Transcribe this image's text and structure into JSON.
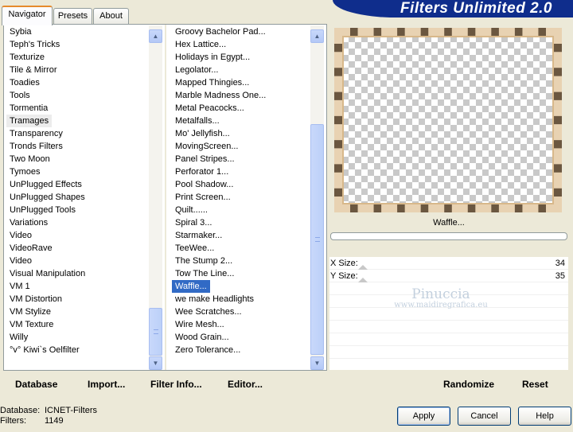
{
  "tabs": [
    {
      "label": "Navigator"
    },
    {
      "label": "Presets"
    },
    {
      "label": "About"
    }
  ],
  "header": {
    "title": "Filters Unlimited 2.0"
  },
  "categories": [
    "Sybia",
    "Teph's Tricks",
    "Texturize",
    "Tile & Mirror",
    "Toadies",
    "Tools",
    "Tormentia",
    "Tramages",
    "Transparency",
    "Tronds Filters",
    "Two Moon",
    "Tymoes",
    "UnPlugged Effects",
    "UnPlugged Shapes",
    "UnPlugged Tools",
    "Variations",
    "Video",
    "VideoRave",
    "Video",
    "Visual Manipulation",
    "VM 1",
    "VM Distortion",
    "VM Stylize",
    "VM Texture",
    "Willy",
    "°v° Kiwi`s Oelfilter"
  ],
  "selected_category": "Tramages",
  "filters": [
    "Groovy Bachelor Pad...",
    "Hex Lattice...",
    "Holidays in Egypt...",
    "Legolator...",
    "Mapped Thingies...",
    "Marble Madness One...",
    "Metal Peacocks...",
    "Metalfalls...",
    "Mo' Jellyfish...",
    "MovingScreen...",
    "Panel Stripes...",
    "Perforator 1...",
    "Pool Shadow...",
    "Print Screen...",
    "Quilt......",
    "Spiral 3...",
    "Starmaker...",
    "TeeWee...",
    "The Stump 2...",
    "Tow The Line...",
    "Waffle...",
    "we make Headlights",
    "Wee Scratches...",
    "Wire Mesh...",
    "Wood Grain...",
    "Zero Tolerance..."
  ],
  "selected_filter": "Waffle...",
  "left_buttons": {
    "database": "Database",
    "import": "Import...",
    "filter_info": "Filter Info...",
    "editor": "Editor..."
  },
  "preview": {
    "filter_name": "Waffle...",
    "progress": 0
  },
  "params": [
    {
      "label": "X Size:",
      "value": "34"
    },
    {
      "label": "Y Size:",
      "value": "35"
    }
  ],
  "watermark": {
    "line1": "Pinuccia",
    "line2": "www.maidiregrafica.eu"
  },
  "right_buttons": {
    "randomize": "Randomize",
    "reset": "Reset"
  },
  "status": {
    "database_label": "Database:",
    "database_value": "ICNET-Filters",
    "filters_label": "Filters:",
    "filters_value": "1149"
  },
  "dialog_buttons": {
    "apply": "Apply",
    "cancel": "Cancel",
    "help": "Help"
  }
}
